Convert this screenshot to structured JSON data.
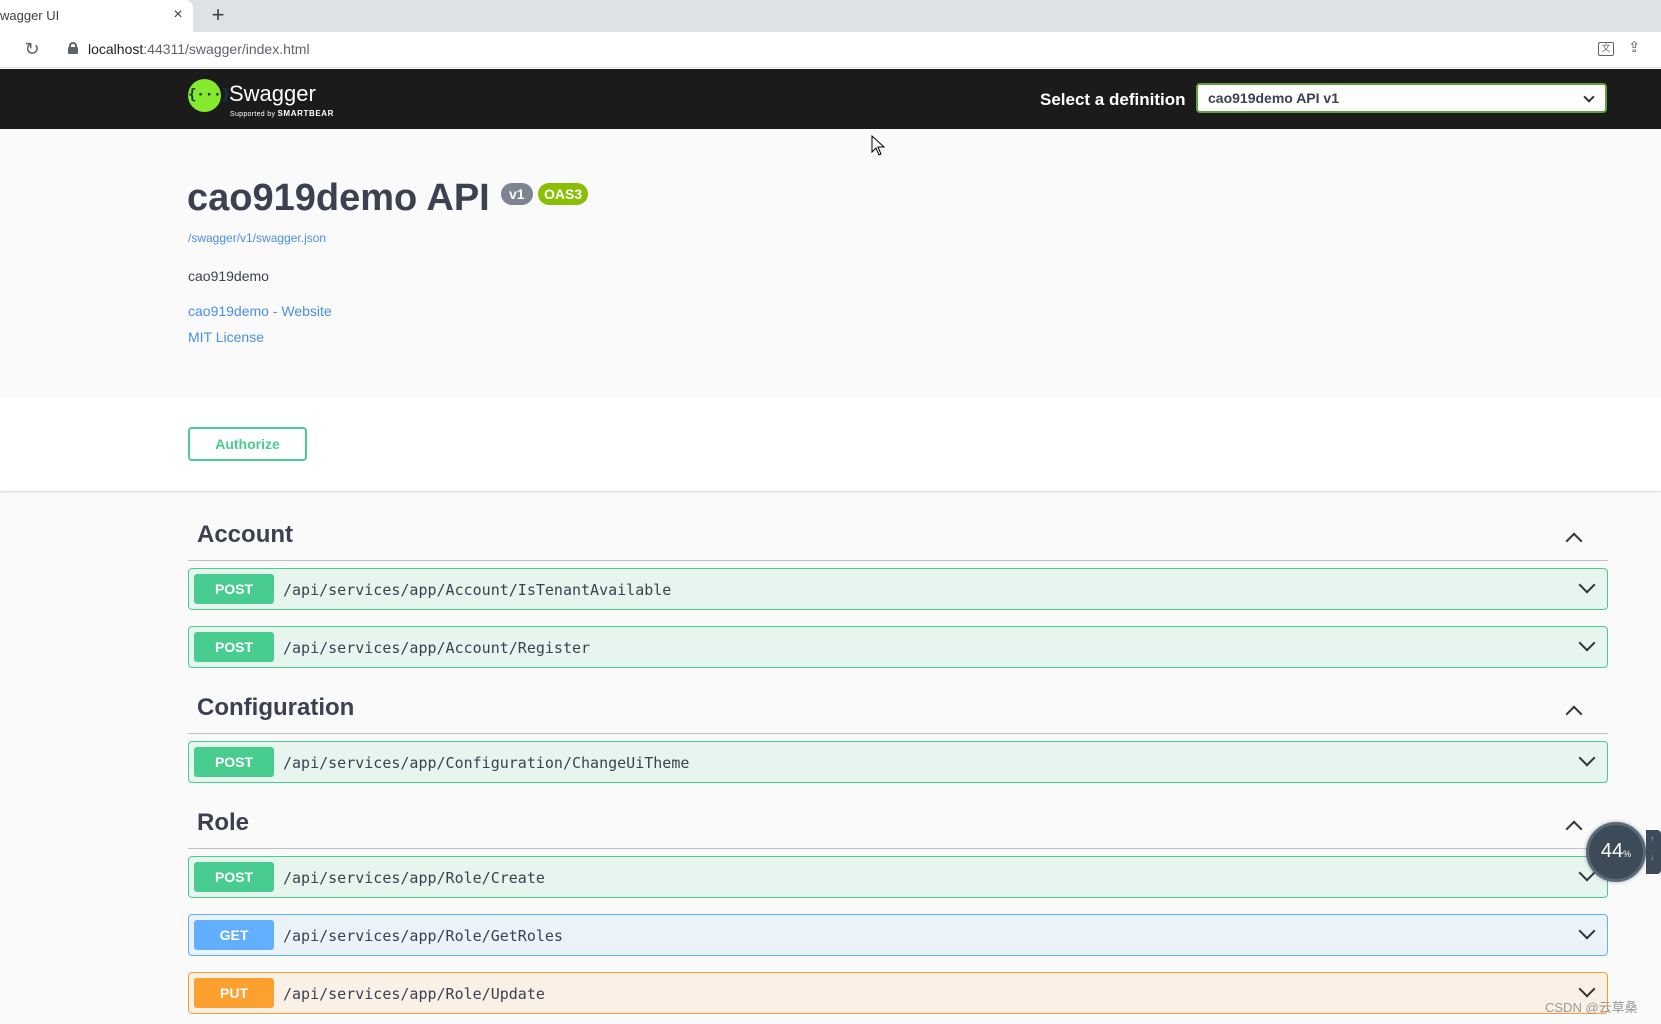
{
  "browser": {
    "tab_title": "wagger UI",
    "close_glyph": "×",
    "new_tab_glyph": "+",
    "url_host": "localhost",
    "url_port_path": ":44311/swagger/index.html"
  },
  "topbar": {
    "logo_glyph": "{···}",
    "logo_text": "Swagger",
    "logo_sub_prefix": "Supported by",
    "logo_sub_brand": "SMARTBEAR",
    "select_label": "Select a definition",
    "selected_definition": "cao919demo API v1"
  },
  "info": {
    "title": "cao919demo API",
    "version_badge": "v1",
    "oas_badge": "OAS3",
    "spec_url": "/swagger/v1/swagger.json",
    "description": "cao919demo",
    "website_link": "cao919demo - Website",
    "license_link": "MIT License"
  },
  "scheme": {
    "authorize_label": "Authorize"
  },
  "tags": [
    {
      "name": "Account",
      "operations": [
        {
          "method": "POST",
          "path": "/api/services/app/Account/IsTenantAvailable"
        },
        {
          "method": "POST",
          "path": "/api/services/app/Account/Register"
        }
      ]
    },
    {
      "name": "Configuration",
      "operations": [
        {
          "method": "POST",
          "path": "/api/services/app/Configuration/ChangeUiTheme"
        }
      ]
    },
    {
      "name": "Role",
      "operations": [
        {
          "method": "POST",
          "path": "/api/services/app/Role/Create"
        },
        {
          "method": "GET",
          "path": "/api/services/app/Role/GetRoles"
        },
        {
          "method": "PUT",
          "path": "/api/services/app/Role/Update"
        }
      ]
    }
  ],
  "widget": {
    "value": "44",
    "unit": "%"
  },
  "watermark": "CSDN @云草桑",
  "colors": {
    "post": "#49cc90",
    "get": "#61affe",
    "put": "#fca130",
    "swagger_green": "#85ea2d",
    "topbar": "#1b1b1b",
    "link": "#4990e2"
  }
}
